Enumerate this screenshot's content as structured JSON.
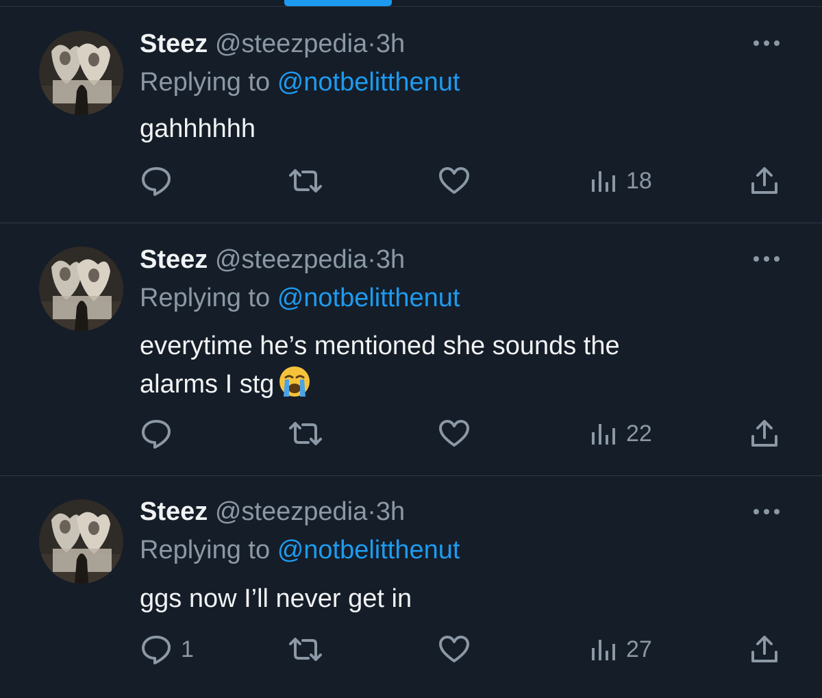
{
  "tweets": [
    {
      "name": "Steez",
      "handle": "@steezpedia",
      "separator": "·",
      "time": "3h",
      "replying_prefix": "Replying to",
      "replying_to": "@notbelitthenut",
      "text_lines": [
        "gahhhhhh"
      ],
      "emoji": "",
      "reply_count": "",
      "views": "18"
    },
    {
      "name": "Steez",
      "handle": "@steezpedia",
      "separator": "·",
      "time": "3h",
      "replying_prefix": "Replying to",
      "replying_to": "@notbelitthenut",
      "text_lines": [
        "everytime he’s mentioned she sounds the",
        "alarms I stg"
      ],
      "emoji": "loudly-crying-face",
      "reply_count": "",
      "views": "22"
    },
    {
      "name": "Steez",
      "handle": "@steezpedia",
      "separator": "·",
      "time": "3h",
      "replying_prefix": "Replying to",
      "replying_to": "@notbelitthenut",
      "text_lines": [
        "ggs now I’ll never get in"
      ],
      "emoji": "",
      "reply_count": "1",
      "views": "27"
    }
  ],
  "icons": {
    "reply": "reply-icon",
    "retweet": "retweet-icon",
    "like": "heart-icon",
    "views": "views-icon",
    "share": "share-icon",
    "more": "more-icon"
  },
  "colors": {
    "background": "#151d28",
    "accent": "#1d9bf0",
    "muted": "#8b98a5",
    "text": "#f1f3f4"
  }
}
